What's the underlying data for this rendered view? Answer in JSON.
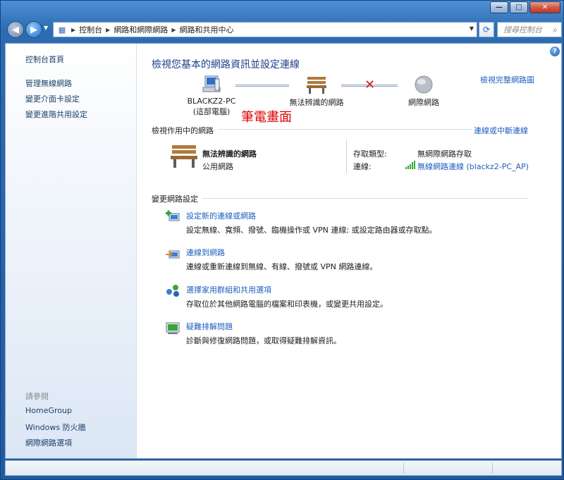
{
  "window": {
    "min_symbol": "—",
    "max_symbol": "□",
    "close_symbol": "✕"
  },
  "address": {
    "crumbs": [
      "控制台",
      "網路和網際網路",
      "網路和共用中心"
    ],
    "search_placeholder": "搜尋控制台"
  },
  "sidebar": {
    "home": "控制台首頁",
    "links": [
      "管理無線網路",
      "變更介面卡設定",
      "變更進階共用設定"
    ],
    "see_also_heading": "請參閱",
    "see_also": [
      "HomeGroup",
      "Windows 防火牆",
      "網際網路選項"
    ]
  },
  "main": {
    "title": "檢視您基本的網路資訊並設定連線",
    "full_map_link": "檢視完整網路圖",
    "map": {
      "computer_name": "BLACKZ2-PC",
      "computer_sub": "(這部電腦)",
      "network_label": "無法辨識的網路",
      "internet_label": "網際網路"
    },
    "annotation": "筆電畫面",
    "active_networks": {
      "heading": "檢視作用中的網路",
      "connect_link": "連線或中斷連線",
      "network_name": "無法辨識的網路",
      "network_type": "公用網路",
      "access_type_label": "存取類型:",
      "access_type_value": "無網際網路存取",
      "connections_label": "連線:",
      "connections_value": "無線網路連線 (blackz2-PC_AP)"
    },
    "change_settings": {
      "heading": "變更網路設定",
      "tasks": [
        {
          "title": "設定新的連線或網路",
          "desc": "設定無線、寬頻、撥號、臨機操作或 VPN 連線; 或設定路由器或存取點。"
        },
        {
          "title": "連線到網路",
          "desc": "連線或重新連線到無線、有線、撥號或 VPN 網路連線。"
        },
        {
          "title": "選擇家用群組和共用選項",
          "desc": "存取位於其他網路電腦的檔案和印表機，或變更共用設定。"
        },
        {
          "title": "疑難排解問題",
          "desc": "診斷與修復網路問題，或取得疑難排解資訊。"
        }
      ]
    }
  },
  "colors": {
    "link": "#1f5fbf",
    "title": "#1f3e8a",
    "annotation": "#e00000",
    "error_x": "#d01818"
  }
}
